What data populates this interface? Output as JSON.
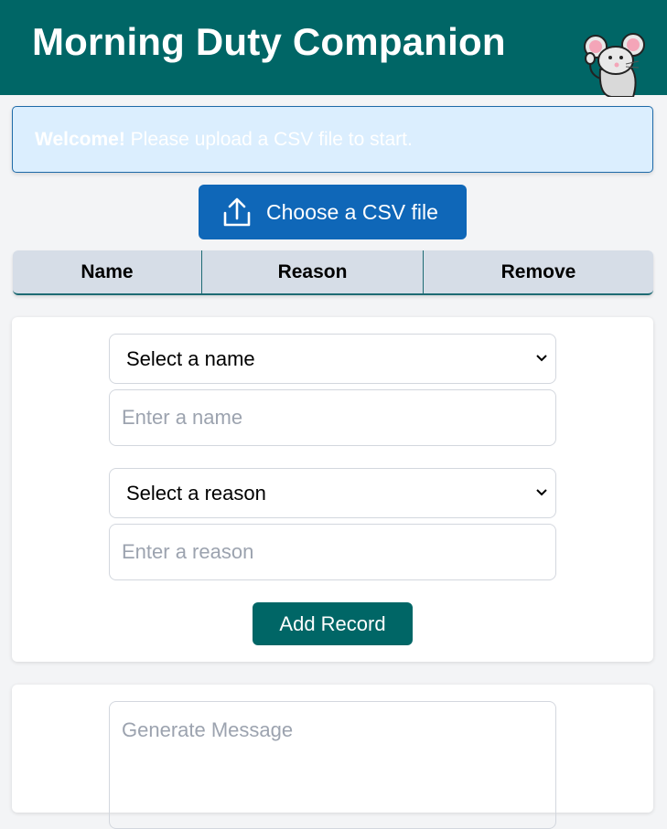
{
  "header": {
    "title": "Morning Duty Companion"
  },
  "alert": {
    "strong": "Welcome!",
    "text": " Please upload a CSV file to start."
  },
  "upload": {
    "label": "Choose a CSV file",
    "icon": "upload-icon"
  },
  "table": {
    "columns": [
      "Name",
      "Reason",
      "Remove"
    ]
  },
  "form": {
    "name_select": "Select a name",
    "name_placeholder": "Enter a name",
    "reason_select": "Select a reason",
    "reason_placeholder": "Enter a reason",
    "add_label": "Add Record"
  },
  "message": {
    "placeholder": "Generate Message"
  },
  "colors": {
    "brand": "#006666",
    "primary": "#0f67b8",
    "alert_bg": "#dbeefe"
  }
}
